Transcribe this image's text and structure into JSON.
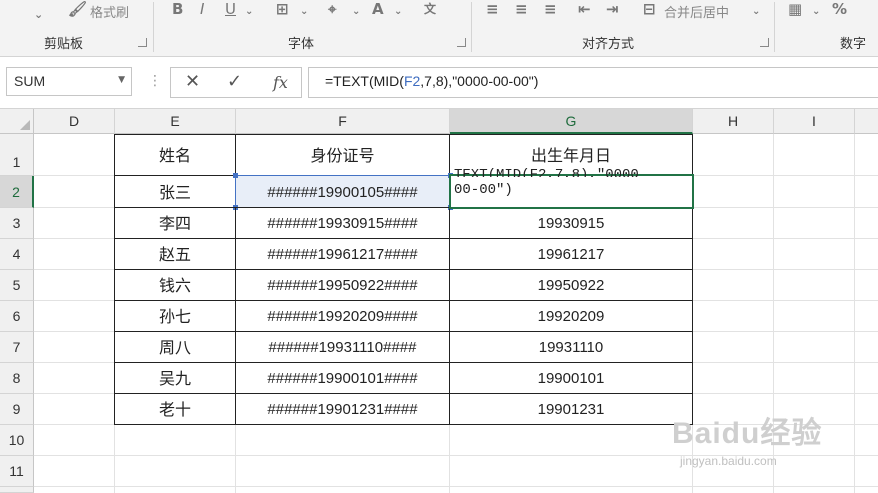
{
  "ribbon": {
    "clipboard_label": "剪贴板",
    "format_painter_label": "格式刷",
    "font_label": "字体",
    "align_label": "对齐方式",
    "merge_label": "合并后居中",
    "number_label": "数字"
  },
  "formula_bar": {
    "name_box": "SUM",
    "fx_label": "fx",
    "formula_prefix": "=TEXT(MID(",
    "formula_ref": "F2",
    "formula_suffix": ",7,8),\"0000-00-00\")"
  },
  "columns": [
    "D",
    "E",
    "F",
    "G",
    "H",
    "I"
  ],
  "rows": [
    "1",
    "2",
    "3",
    "4",
    "5",
    "6",
    "7",
    "8",
    "9",
    "10",
    "11"
  ],
  "table": {
    "headers": [
      "姓名",
      "身份证号",
      "出生年月日"
    ],
    "rows": [
      {
        "name": "张三",
        "id": "######19900105####",
        "birth": ""
      },
      {
        "name": "李四",
        "id": "######19930915####",
        "birth": "19930915"
      },
      {
        "name": "赵五",
        "id": "######19961217####",
        "birth": "19961217"
      },
      {
        "name": "钱六",
        "id": "######19950922####",
        "birth": "19950922"
      },
      {
        "name": "孙七",
        "id": "######19920209####",
        "birth": "19920209"
      },
      {
        "name": "周八",
        "id": "######19931110####",
        "birth": "19931110"
      },
      {
        "name": "吴九",
        "id": "######19900101####",
        "birth": "19900101"
      },
      {
        "name": "老十",
        "id": "######19901231####",
        "birth": "19901231"
      }
    ]
  },
  "editing_cell": {
    "line1": "TEXT(MID(F2,7,8),\"0000",
    "line2": "00-00\")"
  },
  "watermark": {
    "main": "Baidu经验",
    "sub": "jingyan.baidu.com"
  }
}
